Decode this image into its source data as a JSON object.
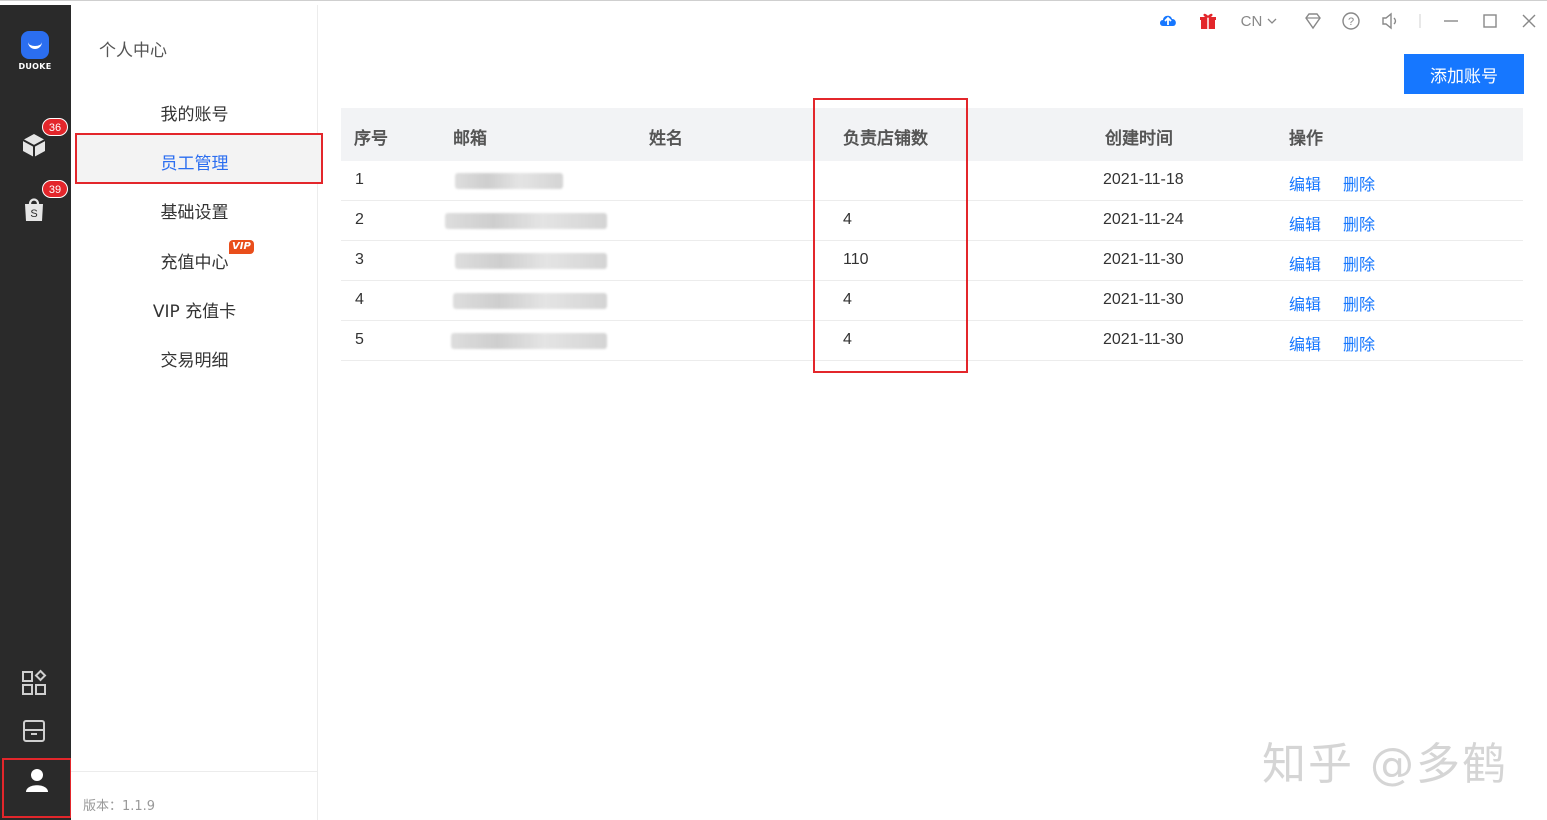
{
  "app": {
    "logo_text": "DUOKE",
    "language": "CN",
    "version_label": "版本：1.1.9"
  },
  "rail": {
    "badges": [
      "36",
      "39"
    ]
  },
  "menu": {
    "title": "个人中心",
    "items": [
      {
        "label": "我的账号"
      },
      {
        "label": "员工管理"
      },
      {
        "label": "基础设置"
      },
      {
        "label": "充值中心"
      },
      {
        "label": "VIP 充值卡"
      },
      {
        "label": "交易明细"
      }
    ],
    "vip_tag": "VIP",
    "active_index": 1
  },
  "toolbar": {
    "add_button_label": "添加账号"
  },
  "table": {
    "headers": [
      "序号",
      "邮箱",
      "姓名",
      "负责店铺数",
      "创建时间",
      "操作"
    ],
    "rows": [
      {
        "index": "1",
        "stores": "",
        "created": "2021-11-18",
        "edit": "编辑",
        "delete": "删除"
      },
      {
        "index": "2",
        "stores": "4",
        "created": "2021-11-24",
        "edit": "编辑",
        "delete": "删除"
      },
      {
        "index": "3",
        "stores": "110",
        "created": "2021-11-30",
        "edit": "编辑",
        "delete": "删除"
      },
      {
        "index": "4",
        "stores": "4",
        "created": "2021-11-30",
        "edit": "编辑",
        "delete": "删除"
      },
      {
        "index": "5",
        "stores": "4",
        "created": "2021-11-30",
        "edit": "编辑",
        "delete": "删除"
      }
    ]
  },
  "watermark": "知乎 @多鹤",
  "colors": {
    "accent": "#1677ff",
    "rail_bg": "#2a2a2a",
    "highlight": "#e3262b",
    "header_bg": "#f2f3f5"
  }
}
